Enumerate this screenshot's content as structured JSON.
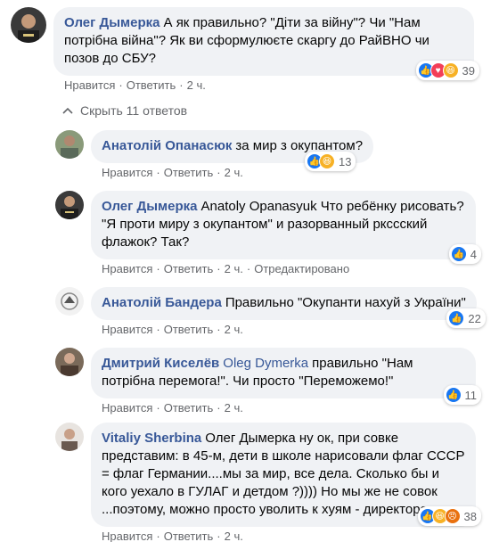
{
  "collapse_label": "Скрыть 11 ответов",
  "comments": [
    {
      "author": "Олег Дымерка",
      "text": "А як правильно? \"Діти за війну\"? Чи \"Нам потрібна війна\"? Як ви сформулюєте скаргу до РайВНО чи позов до СБУ?",
      "actions": [
        "Нравится",
        "Ответить",
        "2 ч."
      ],
      "reactions": {
        "count": "39",
        "icons": [
          "like",
          "love",
          "haha"
        ]
      }
    },
    {
      "author": "Анатолій Опанасюк",
      "text": "за мир з окупантом?",
      "actions": [
        "Нравится",
        "Ответить",
        "2 ч."
      ],
      "reactions": {
        "count": "13",
        "icons": [
          "like",
          "haha"
        ]
      }
    },
    {
      "author": "Олег Дымерка",
      "mention": "",
      "text": "Anatoly Opanasyuk Что ребёнку рисовать? \"Я проти миру з окупантом\" и разорванный ркссский флажок? Так?",
      "actions": [
        "Нравится",
        "Ответить",
        "2 ч.",
        "Отредактировано"
      ],
      "reactions": {
        "count": "4",
        "icons": [
          "like"
        ]
      }
    },
    {
      "author": "Анатолій Бандера",
      "text": "Правильно \"Окупанти нахуй з України\"",
      "actions": [
        "Нравится",
        "Ответить",
        "2 ч."
      ],
      "reactions": {
        "count": "22",
        "icons": [
          "like"
        ]
      }
    },
    {
      "author": "Дмитрий Киселёв",
      "mention": "Oleg Dymerka",
      "text": "правильно \"Нам потрібна перемога!\". Чи просто \"Переможемо!\"",
      "actions": [
        "Нравится",
        "Ответить",
        "2 ч."
      ],
      "reactions": {
        "count": "11",
        "icons": [
          "like"
        ]
      }
    },
    {
      "author": "Vitaliy Sherbina",
      "text": "Олег Дымерка ну ок, при совке представим: в 45-м, дети в школе нарисовали флаг СССР = флаг Германии....мы за мир, все дела. Сколько бы и кого уехало в ГУЛАГ и детдом ?)))) Но мы же не совок ...поэтому, можно просто уволить к хуям - директора",
      "actions": [
        "Нравится",
        "Ответить",
        "2 ч."
      ],
      "reactions": {
        "count": "38",
        "icons": [
          "like",
          "haha",
          "angry"
        ]
      }
    }
  ],
  "colors": {
    "link": "#385898",
    "bubble": "#f0f2f5",
    "meta": "#65676b",
    "like": "#1877f2"
  }
}
